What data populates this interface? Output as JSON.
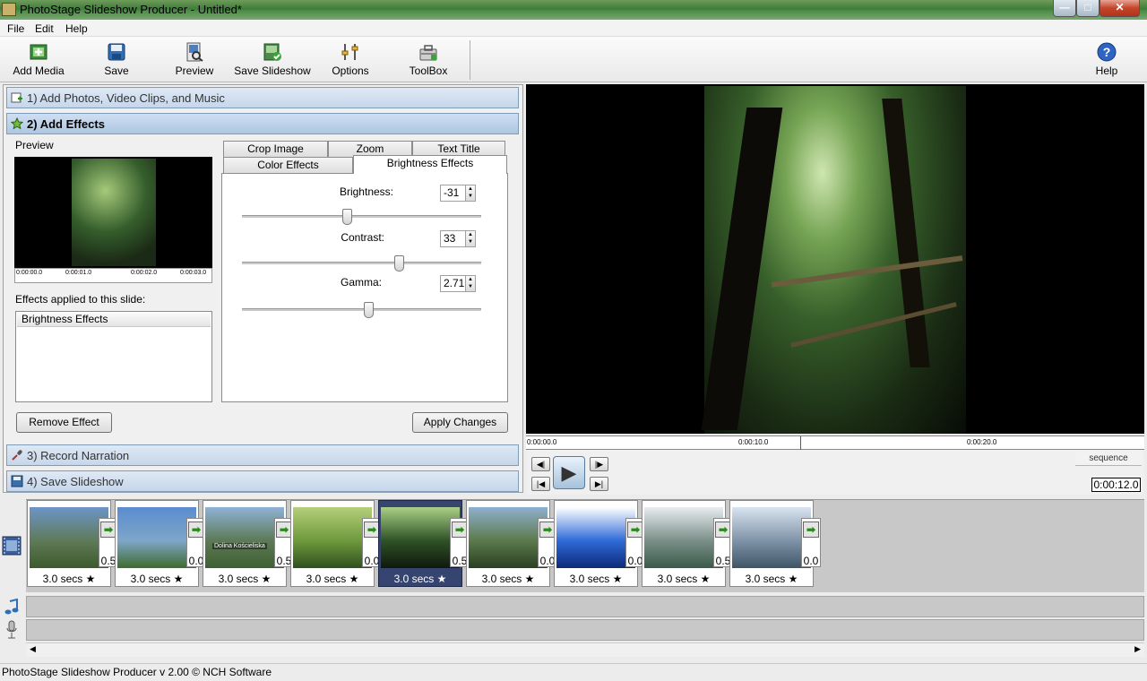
{
  "window": {
    "title": "PhotoStage Slideshow Producer - Untitled*"
  },
  "menu": [
    "File",
    "Edit",
    "Help"
  ],
  "toolbar": {
    "add_media": "Add Media",
    "save": "Save",
    "preview": "Preview",
    "save_slideshow": "Save Slideshow",
    "options": "Options",
    "toolbox": "ToolBox",
    "help": "Help"
  },
  "steps": {
    "s1": "1)  Add Photos, Video Clips, and Music",
    "s2": "2)  Add Effects",
    "s3": "3)  Record Narration",
    "s4": "4)  Save Slideshow"
  },
  "effects": {
    "preview_label": "Preview",
    "ruler": [
      "0:00:00.0",
      "0:00:01.0",
      "0:00:02.0",
      "0:00:03.0"
    ],
    "applied_label": "Effects applied to this slide:",
    "applied": [
      "Brightness Effects"
    ],
    "remove_button": "Remove Effect",
    "apply_button": "Apply Changes",
    "tabs": {
      "crop": "Crop Image",
      "zoom": "Zoom",
      "text": "Text Title",
      "color": "Color Effects",
      "brightness": "Brightness Effects"
    },
    "brightness_label": "Brightness:",
    "brightness_value": "-31",
    "contrast_label": "Contrast:",
    "contrast_value": "33",
    "gamma_label": "Gamma:",
    "gamma_value": "2.71"
  },
  "player": {
    "timeline_marks": [
      "0:00:00.0",
      "0:00:10.0",
      "0:00:20.0"
    ],
    "sequence_tab": "sequence",
    "timecode": "0:00:12.0"
  },
  "storyboard": {
    "slides": [
      {
        "duration": "3.0 secs",
        "transition": "0.5",
        "colors": [
          "#6c95c9",
          "#5f7a58",
          "#3d5a2c"
        ]
      },
      {
        "duration": "3.0 secs",
        "transition": "0.0",
        "colors": [
          "#5a8ccf",
          "#7fa6c9",
          "#3e6b2e"
        ]
      },
      {
        "duration": "3.0 secs",
        "transition": "0.5",
        "colors": [
          "#8fb2d6",
          "#5c7a55",
          "#3f5f33"
        ],
        "caption": "Dolina Kościeliska"
      },
      {
        "duration": "3.0 secs",
        "transition": "0.0",
        "colors": [
          "#b5cf7a",
          "#6e9a3c",
          "#2f4f1f"
        ]
      },
      {
        "duration": "3.0 secs",
        "transition": "0.5",
        "colors": [
          "#a9cf86",
          "#2f5227",
          "#0f180c"
        ]
      },
      {
        "duration": "3.0 secs",
        "transition": "0.0",
        "colors": [
          "#8fb0cf",
          "#5c7a4c",
          "#2a3f22"
        ]
      },
      {
        "duration": "3.0 secs",
        "transition": "0.0",
        "colors": [
          "#ffffff",
          "#2f6bd8",
          "#0d2a78"
        ]
      },
      {
        "duration": "3.0 secs",
        "transition": "0.5",
        "colors": [
          "#e8ecf0",
          "#7a8f88",
          "#3a5a4a"
        ]
      },
      {
        "duration": "3.0 secs",
        "transition": "0.0",
        "colors": [
          "#d8e4f0",
          "#7f93a8",
          "#3f5566"
        ]
      }
    ],
    "selected_index": 4
  },
  "status": "PhotoStage Slideshow Producer v 2.00 © NCH Software"
}
